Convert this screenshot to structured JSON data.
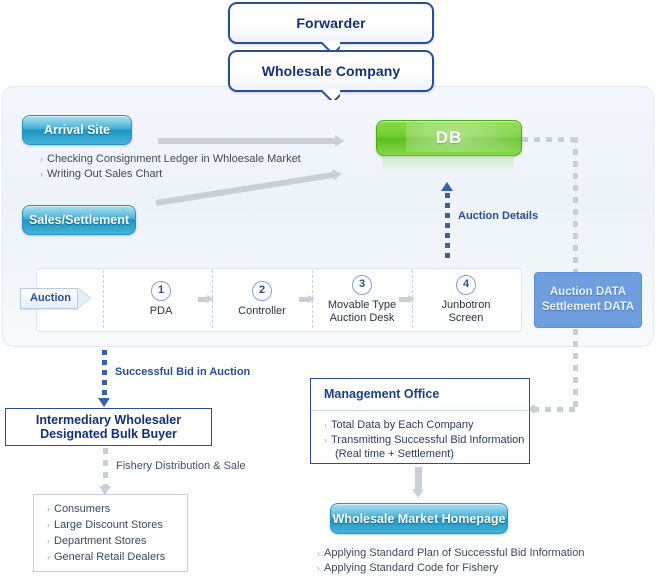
{
  "top": {
    "forwarder": "Forwarder",
    "wholesale_company": "Wholesale Company"
  },
  "panel": {
    "arrival_site": "Arrival Site",
    "sales_settlement": "Sales/Settlement",
    "arrival_bullets": [
      "Checking Consignment Ledger in Whloesale Market",
      "Writing Out Sales Chart"
    ],
    "db": "DB",
    "auction_details_label": "Auction Details",
    "auction_tag": "Auction",
    "steps": [
      {
        "num": "1",
        "line1": "PDA",
        "line2": ""
      },
      {
        "num": "2",
        "line1": "Controller",
        "line2": ""
      },
      {
        "num": "3",
        "line1": "Movable Type",
        "line2": "Auction Desk"
      },
      {
        "num": "4",
        "line1": "Junbotron",
        "line2": "Screen"
      }
    ],
    "data_box_line1": "Auction DATA",
    "data_box_line2": "Settlement DATA"
  },
  "lower_left": {
    "successful_bid_label": "Successful Bid in Auction",
    "intermediary_line1": "Intermediary Wholesaler",
    "intermediary_line2": "Designated Bulk Buyer",
    "fishery_label": "Fishery Distribution & Sale",
    "consumer_bullets": [
      "Consumers",
      "Large Discount Stores",
      "Department Stores",
      "General Retail Dealers"
    ]
  },
  "lower_right": {
    "management_office_title": "Management Office",
    "management_bullets": [
      "Total Data by Each Company",
      "Transmitting Successful Bid Information",
      "(Real  time + Settlement)"
    ],
    "homepage_label": "Wholesale Market Homepage",
    "homepage_bullets": [
      "Applying Standard Plan of Successful Bid Information",
      "Applying Standard Code for Fishery"
    ]
  },
  "colors": {
    "navy": "#14307d",
    "blue_accent": "#2a4d9b",
    "cyan_button": "#2f9fc8",
    "green_db": "#6fce2e",
    "data_blue": "#6f9ede",
    "gray_line": "#c9cfd6"
  }
}
